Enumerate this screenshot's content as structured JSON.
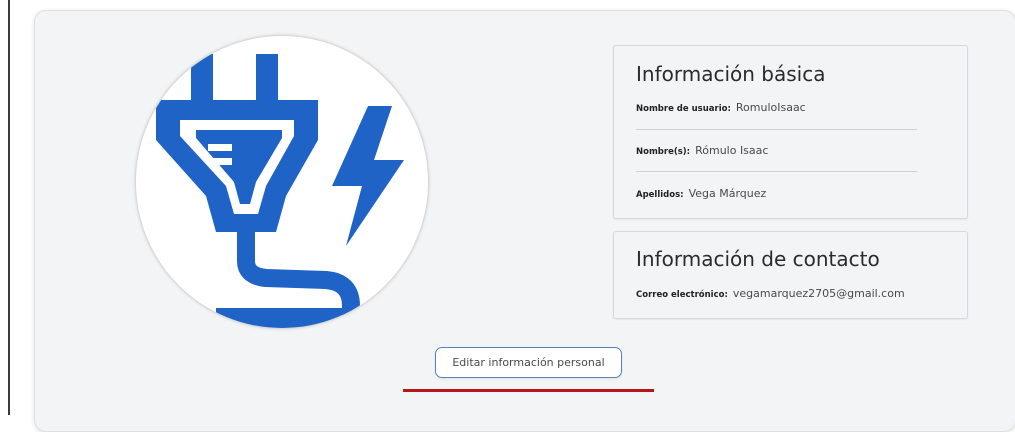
{
  "profile": {
    "avatar_icon": "power-plug-lightning-icon",
    "avatar_color": "#1f63c6"
  },
  "basic_info": {
    "title": "Información básica",
    "username_label": "Nombre de usuario:",
    "username_value": "RomuloIsaac",
    "first_name_label": "Nombre(s):",
    "first_name_value": "Rómulo Isaac",
    "last_name_label": "Apellidos:",
    "last_name_value": "Vega Márquez"
  },
  "contact_info": {
    "title": "Información de contacto",
    "email_label": "Correo electrónico:",
    "email_value": "vegamarquez2705@gmail.com"
  },
  "actions": {
    "edit_label": "Editar información personal",
    "accent_color": "#5a82b6",
    "underline_color": "#b5161c"
  }
}
